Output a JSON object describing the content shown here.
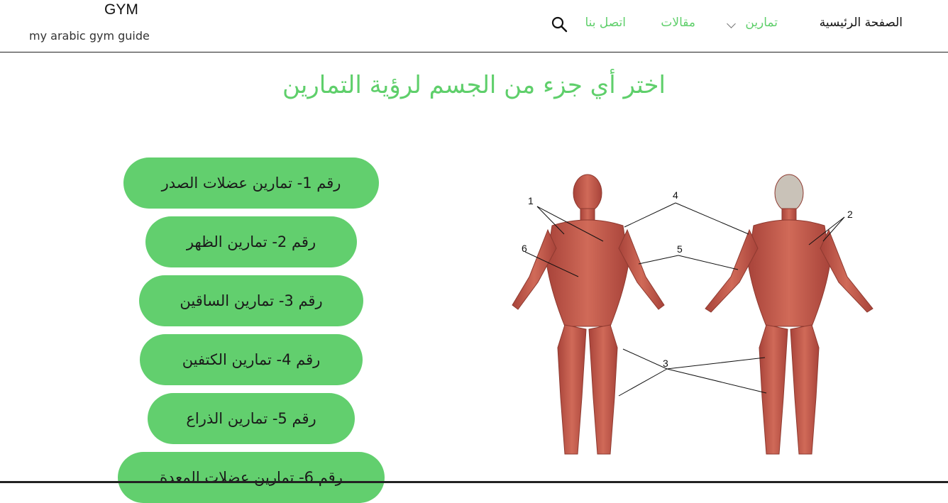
{
  "brand": {
    "title": "GYM",
    "tagline": "my arabic gym guide"
  },
  "nav": {
    "home": "الصفحة الرئيسية",
    "exercises": "تمارين",
    "articles": "مقالات",
    "contact": "اتصل بنا"
  },
  "heading": "اختر أي جزء من الجسم لرؤية التمارين",
  "buttons": [
    "رقم 1- تمارين عضلات الصدر",
    "رقم 2- تمارين الظهر",
    "رقم 3- تمارين الساقين",
    "رقم 4- تمارين الكتفين",
    "رقم 5- تمارين الذراع",
    "رقم 6- تمارين عضلات المعدة"
  ],
  "diagram_labels": [
    "1",
    "2",
    "3",
    "4",
    "5",
    "6"
  ],
  "colors": {
    "accent": "#5fcf6b",
    "button": "#62cf6e",
    "muscle": "#c4584a"
  }
}
